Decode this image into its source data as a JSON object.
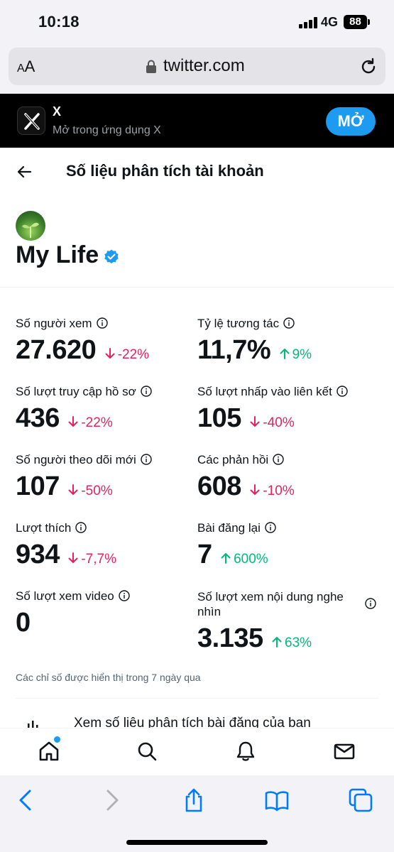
{
  "status_bar": {
    "time": "10:18",
    "network": "4G",
    "battery": "88"
  },
  "browser": {
    "text_size_label_small": "A",
    "text_size_label_large": "A",
    "url": "twitter.com"
  },
  "app_banner": {
    "app_name": "X",
    "subtitle": "Mở trong ứng dụng X",
    "open_button": "MỞ"
  },
  "page": {
    "title": "Số liệu phân tích tài khoản"
  },
  "profile": {
    "name": "My Life"
  },
  "metrics": {
    "viewers": {
      "label": "Số người xem",
      "value": "27.620",
      "change": "-22%",
      "direction": "down"
    },
    "engagement_rate": {
      "label": "Tỷ lệ tương tác",
      "value": "11,7%",
      "change": "9%",
      "direction": "up"
    },
    "profile_visits": {
      "label": "Số lượt truy cập hồ sơ",
      "value": "436",
      "change": "-22%",
      "direction": "down"
    },
    "link_clicks": {
      "label": "Số lượt nhấp vào liên kết",
      "value": "105",
      "change": "-40%",
      "direction": "down"
    },
    "new_followers": {
      "label": "Số người theo dõi mới",
      "value": "107",
      "change": "-50%",
      "direction": "down"
    },
    "replies": {
      "label": "Các phản hồi",
      "value": "608",
      "change": "-10%",
      "direction": "down"
    },
    "likes": {
      "label": "Lượt thích",
      "value": "934",
      "change": "-7,7%",
      "direction": "down"
    },
    "reposts": {
      "label": "Bài đăng lại",
      "value": "7",
      "change": "600%",
      "direction": "up"
    },
    "video_views": {
      "label": "Số lượt xem video",
      "value": "0"
    },
    "media_views": {
      "label": "Số lượt xem nội dung nghe nhìn",
      "value": "3.135",
      "change": "63%",
      "direction": "up"
    }
  },
  "footnote": "Các chỉ số được hiển thị trong 7 ngày qua",
  "post_analytics_link": "Xem số liệu phân tích bài đăng của bạn",
  "bottom_nav": [
    "home-icon",
    "search-icon",
    "notifications-icon",
    "messages-icon"
  ],
  "safari_toolbar": [
    "back-icon",
    "forward-icon",
    "share-icon",
    "bookmarks-icon",
    "tabs-icon"
  ],
  "colors": {
    "accent": "#1d9bf0",
    "negative": "#e0245e",
    "positive": "#00ba7c",
    "banner_bg": "#000000"
  }
}
